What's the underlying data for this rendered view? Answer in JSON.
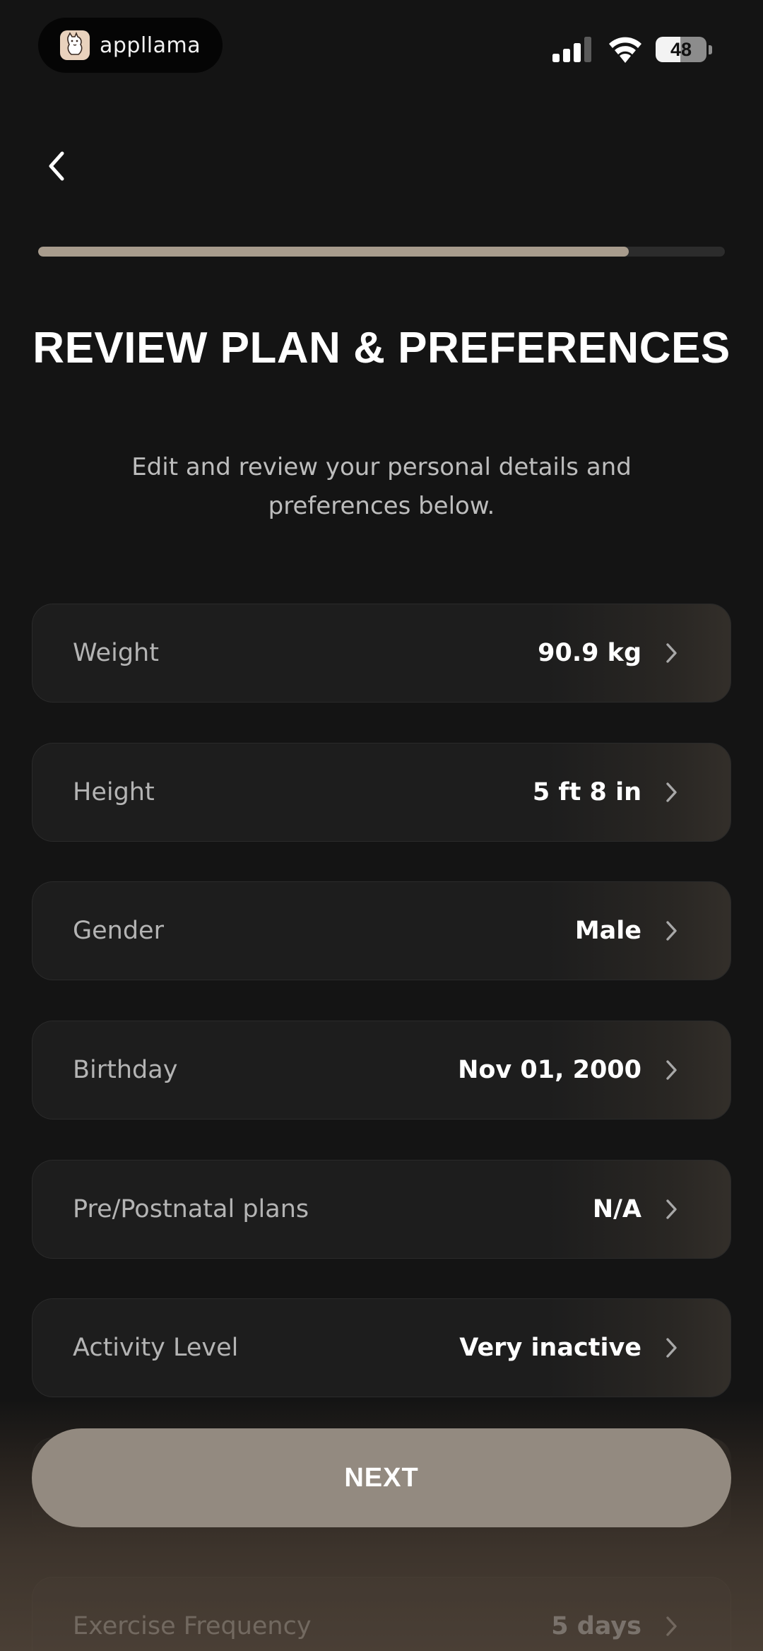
{
  "status_bar": {
    "brand_name": "appllama",
    "battery_level": "48",
    "battery_fraction": 0.48
  },
  "nav": {
    "back_icon": "chevron-left-icon"
  },
  "progress": {
    "value": 0.86
  },
  "header": {
    "title": "REVIEW PLAN & PREFERENCES",
    "subtitle": "Edit and review your personal details and preferences below."
  },
  "rows": [
    {
      "label": "Weight",
      "value": "90.9 kg"
    },
    {
      "label": "Height",
      "value": "5 ft 8 in"
    },
    {
      "label": "Gender",
      "value": "Male"
    },
    {
      "label": "Birthday",
      "value": "Nov 01, 2000"
    },
    {
      "label": "Pre/Postnatal plans",
      "value": "N/A"
    },
    {
      "label": "Activity Level",
      "value": "Very inactive"
    },
    {
      "label": "",
      "value": ""
    },
    {
      "label": "Exercise Frequency",
      "value": "5 days"
    }
  ],
  "footer": {
    "next_label": "NEXT"
  },
  "colors": {
    "background": "#141414",
    "row_background": "#1d1d1d",
    "accent": "#a89c8d",
    "button": "#938a80"
  }
}
